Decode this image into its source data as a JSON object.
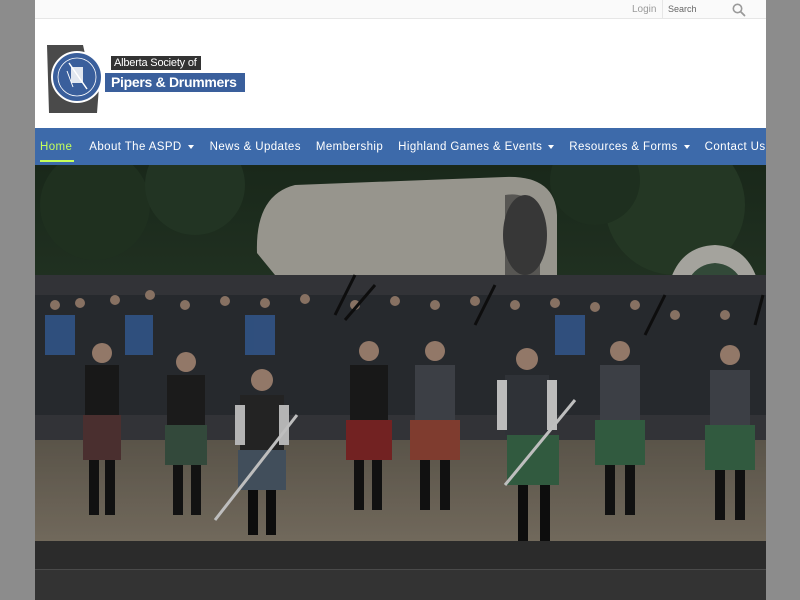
{
  "topbar": {
    "login_label": "Login",
    "search_placeholder": "Search"
  },
  "logo": {
    "line1": "Alberta Society of",
    "line2": "Pipers & Drummers"
  },
  "nav": {
    "items": [
      {
        "label": "Home",
        "active": true,
        "has_dropdown": false
      },
      {
        "label": "About The ASPD",
        "active": false,
        "has_dropdown": true
      },
      {
        "label": "News & Updates",
        "active": false,
        "has_dropdown": false
      },
      {
        "label": "Membership",
        "active": false,
        "has_dropdown": false
      },
      {
        "label": "Highland Games & Events",
        "active": false,
        "has_dropdown": true
      },
      {
        "label": "Resources & Forms",
        "active": false,
        "has_dropdown": true
      },
      {
        "label": "Contact Us",
        "active": false,
        "has_dropdown": false
      }
    ]
  },
  "colors": {
    "nav_bg": "#3d6aaa",
    "nav_active": "#c5ff5a",
    "footer_dark": "#2b2b2b",
    "page_backdrop": "#8c8c8c"
  },
  "icons": {
    "search": "magnifier-icon",
    "dropdown": "chevron-down-icon"
  }
}
